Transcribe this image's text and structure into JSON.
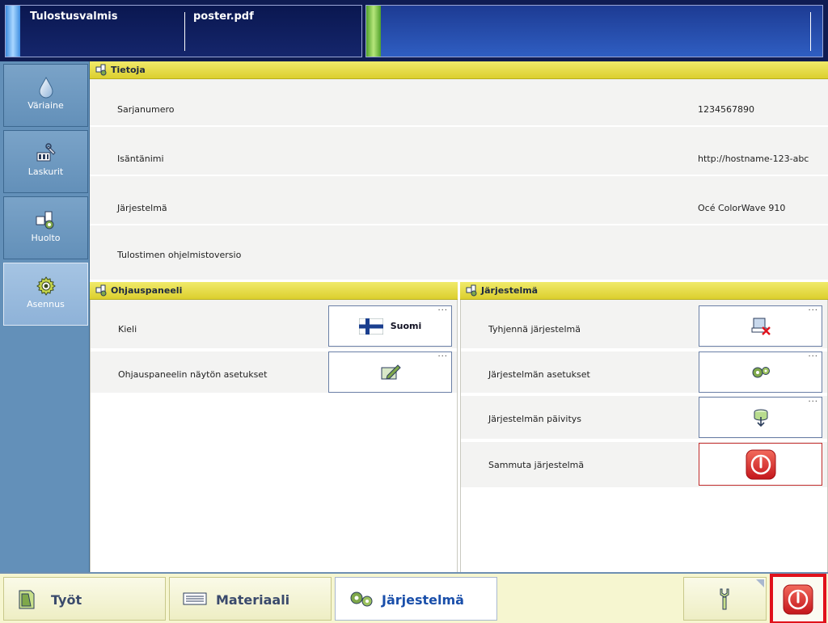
{
  "status": {
    "state": "Tulostusvalmis",
    "file": "poster.pdf"
  },
  "sidebar": {
    "items": [
      {
        "label": "Väriaine",
        "icon": "toner-drop-icon"
      },
      {
        "label": "Laskurit",
        "icon": "counters-icon"
      },
      {
        "label": "Huolto",
        "icon": "maintenance-icon"
      },
      {
        "label": "Asennus",
        "icon": "settings-gear-icon"
      }
    ],
    "active": "Asennus"
  },
  "info": {
    "title": "Tietoja",
    "rows": [
      {
        "label": "Sarjanumero",
        "value": "1234567890"
      },
      {
        "label": "Isäntänimi",
        "value": "http://hostname-123-abc"
      },
      {
        "label": "Järjestelmä",
        "value": "Océ ColorWave 910"
      },
      {
        "label": "Tulostimen ohjelmistoversio",
        "value": ""
      }
    ]
  },
  "control_panel": {
    "title": "Ohjauspaneeli",
    "rows": [
      {
        "label": "Kieli",
        "button": "Suomi",
        "icon": "finland-flag-icon"
      },
      {
        "label": "Ohjauspaneelin näytön asetukset",
        "icon": "edit-screen-icon"
      }
    ]
  },
  "system": {
    "title": "Järjestelmä",
    "rows": [
      {
        "label": "Tyhjennä järjestelmä",
        "icon": "clear-system-icon"
      },
      {
        "label": "Järjestelmän asetukset",
        "icon": "system-settings-icon"
      },
      {
        "label": "Järjestelmän päivitys",
        "icon": "system-update-icon"
      },
      {
        "label": "Sammuta järjestelmä",
        "icon": "shutdown-icon"
      }
    ]
  },
  "bottom_nav": {
    "tabs": [
      {
        "label": "Työt",
        "icon": "jobs-icon"
      },
      {
        "label": "Materiaali",
        "icon": "media-icon"
      },
      {
        "label": "Järjestelmä",
        "icon": "system-icon"
      }
    ],
    "active": "Järjestelmä"
  },
  "more_indicator": "...",
  "colors": {
    "header_yellow": "#dccf2e",
    "sidebar_blue": "#6390b9",
    "topbar_navy": "#0f1c52",
    "accent_blue": "#1a4faa",
    "danger_red": "#e0121c"
  }
}
